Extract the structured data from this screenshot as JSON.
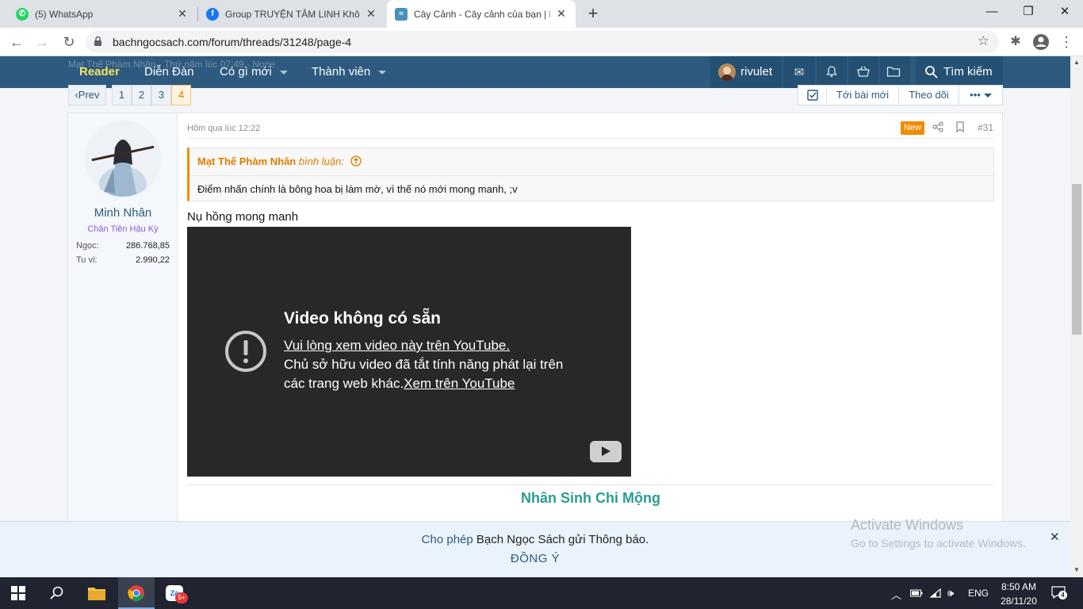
{
  "browser": {
    "tabs": [
      {
        "title": "(5) WhatsApp"
      },
      {
        "title": "Group TRUYỆN TÂM LINH Không"
      },
      {
        "title": "Cây Cảnh - Cây cảnh của bạn | Pa"
      }
    ],
    "url": "bachngocsach.com/forum/threads/31248/page-4"
  },
  "site_nav": {
    "ghost_text": "Mạt Thế Phàm Nhân · Thứ năm lúc 07:49 · None",
    "items": [
      "Reader",
      "Diễn Đàn",
      "Có gì mới",
      "Thành viên"
    ],
    "username": "rivulet",
    "search_label": "Tìm kiếm"
  },
  "pagination": {
    "prev": "Prev",
    "pages": [
      "1",
      "2",
      "3",
      "4"
    ],
    "current": "4"
  },
  "thread_actions": {
    "new_posts": "Tới bài mới",
    "watch": "Theo dõi",
    "more": "•••"
  },
  "post": {
    "author": "Minh Nhân",
    "rank": "Chân Tiên Hậu Kỳ",
    "stats": [
      {
        "label": "Ngọc:",
        "value": "286.768,85"
      },
      {
        "label": "Tu vi:",
        "value": "2.990,22"
      }
    ],
    "time": "Hôm qua lúc 12:22",
    "badge": "New",
    "number": "#31",
    "quote": {
      "author": "Mạt Thế Phàm Nhân",
      "said": "bình luận:",
      "text": "Điểm nhấn chính là bông hoa bị làm mờ, vì thế nó mới mong manh, ;v"
    },
    "body": "Nụ hồng mong manh",
    "video": {
      "title": "Video không có sẵn",
      "link1": "Vui lòng xem video này trên YouTube.",
      "line2": "Chủ sở hữu video đã tắt tính năng phát lại trên",
      "line3": "các trang web khác.",
      "link2": "Xem trên YouTube"
    },
    "signature": "Nhân Sinh Chi Mộng"
  },
  "notification": {
    "allow": "Cho phép",
    "text": "Bạch Ngọc Sách gửi Thông báo.",
    "accept": "ĐỒNG Ý"
  },
  "watermark": {
    "title": "Activate Windows",
    "subtitle": "Go to Settings to activate Windows."
  },
  "taskbar": {
    "language": "ENG",
    "time": "8:50 AM",
    "date": "28/11/20",
    "notifications": "4",
    "zalo_badge": "5+"
  },
  "colors": {
    "nav_bg": "#2d5a7e",
    "accent_orange": "#f28b00",
    "signature": "#2a9d8f",
    "reader": "#f5e663"
  }
}
